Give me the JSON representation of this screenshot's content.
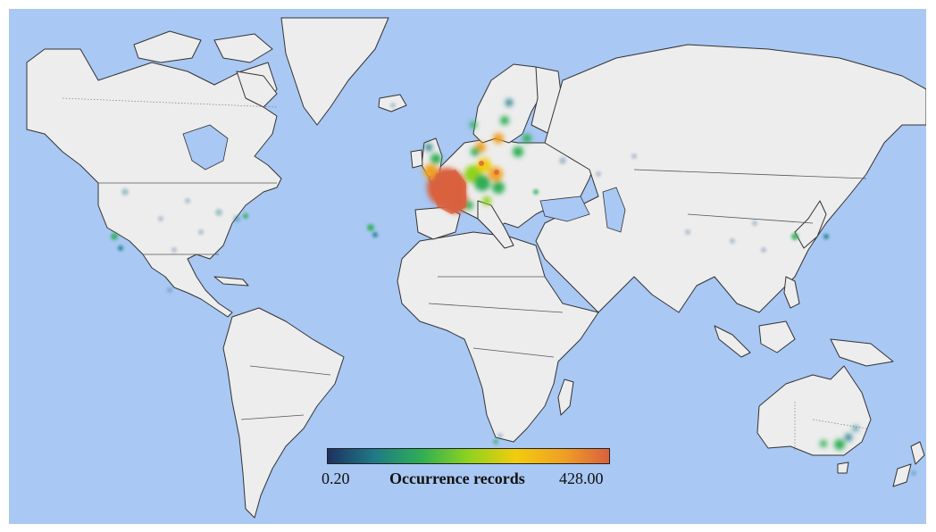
{
  "map": {
    "ocean_color": "#a9c8f3",
    "land_color": "#ededed",
    "border_color": "#333333"
  },
  "legend": {
    "min_label": "0.20",
    "max_label": "428.00",
    "title": "Occurrence records",
    "gradient_colors": [
      "#1e3161",
      "#1f7a86",
      "#2fae55",
      "#8fd21f",
      "#f2cc0e",
      "#f0a124",
      "#d9613e"
    ]
  },
  "hotspots": [
    {
      "region": "France",
      "intensity": 428
    },
    {
      "region": "Benelux",
      "intensity": 380
    },
    {
      "region": "Germany",
      "intensity": 300
    },
    {
      "region": "Denmark",
      "intensity": 260
    },
    {
      "region": "Southern Sweden",
      "intensity": 240
    },
    {
      "region": "Great Britain",
      "intensity": 160
    },
    {
      "region": "Norway coast",
      "intensity": 120
    },
    {
      "region": "Poland",
      "intensity": 90
    },
    {
      "region": "Baltic states",
      "intensity": 70
    },
    {
      "region": "Southeast Australia",
      "intensity": 110
    },
    {
      "region": "Eastern United States",
      "intensity": 30
    },
    {
      "region": "California",
      "intensity": 25
    },
    {
      "region": "Japan",
      "intensity": 20
    },
    {
      "region": "Eastern China",
      "intensity": 8
    },
    {
      "region": "New Zealand",
      "intensity": 10
    },
    {
      "region": "South Africa",
      "intensity": 6
    }
  ]
}
